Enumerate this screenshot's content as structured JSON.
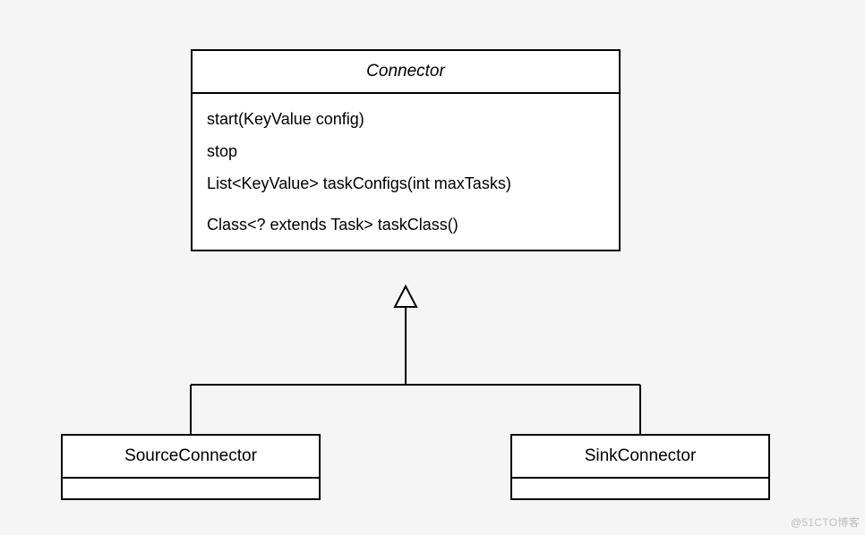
{
  "diagram": {
    "type": "uml-class",
    "parent": {
      "name": "Connector",
      "abstract": true,
      "methods": [
        "start(KeyValue config)",
        "stop",
        "List<KeyValue> taskConfigs(int maxTasks)",
        "Class<? extends Task> taskClass()"
      ]
    },
    "children": [
      {
        "name": "SourceConnector"
      },
      {
        "name": "SinkConnector"
      }
    ],
    "relationship": "generalization"
  },
  "watermark": "@51CTO博客"
}
